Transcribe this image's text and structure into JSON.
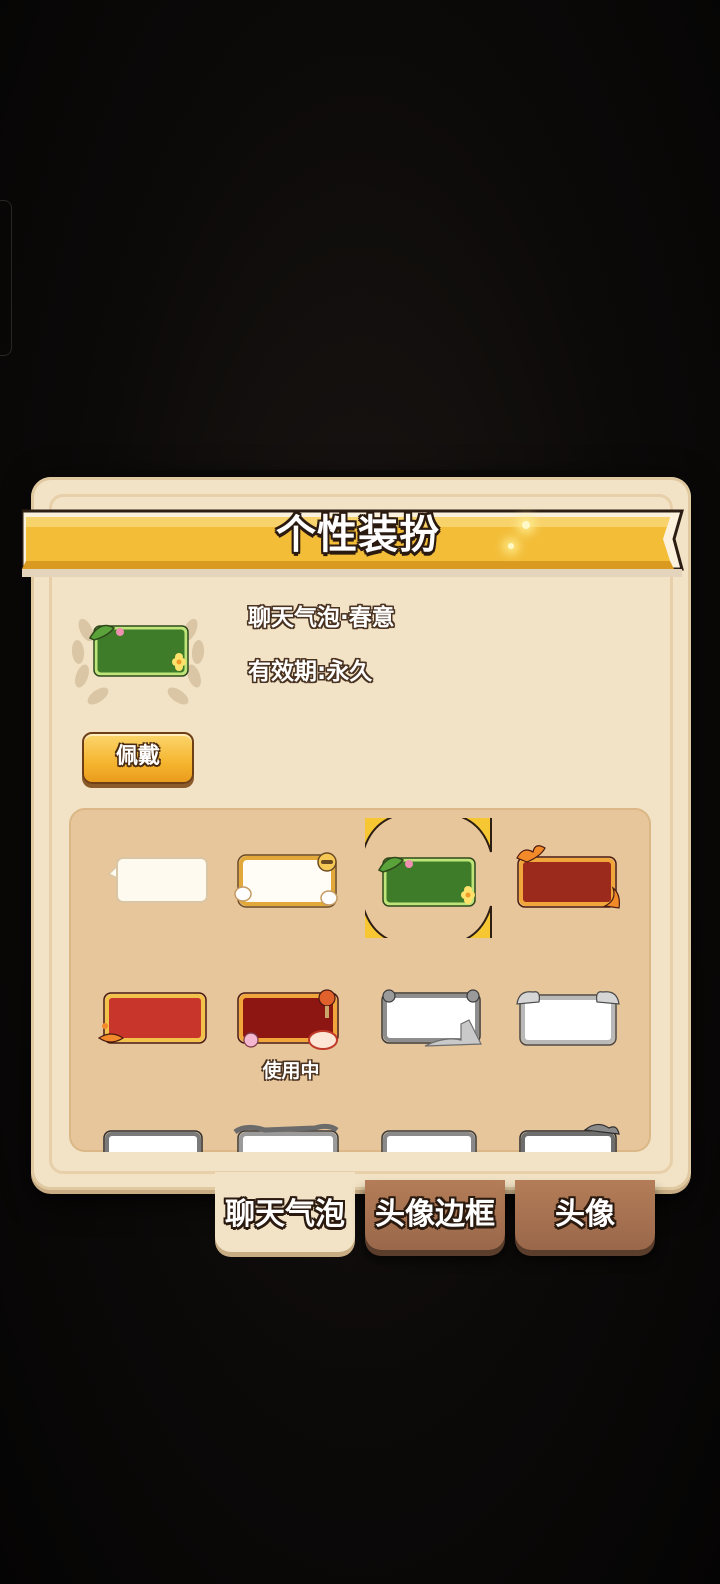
{
  "title": "个性装扮",
  "selected": {
    "name": "聊天气泡·春意",
    "validity": "有效期:永久",
    "wear_button": "佩戴"
  },
  "grid": {
    "in_use_label": "使用中",
    "items": [
      {
        "icon": "plain-white-bubble"
      },
      {
        "icon": "cream-cat-paw-bubble"
      },
      {
        "icon": "spring-green-bubble",
        "selected": true
      },
      {
        "icon": "flame-red-bubble"
      },
      {
        "icon": "red-koi-bubble"
      },
      {
        "icon": "lantern-red-bubble",
        "in_use": true
      },
      {
        "icon": "gray-stone-bubble"
      },
      {
        "icon": "white-cloud-bubble"
      },
      {
        "icon": "dark-gray-bubble"
      },
      {
        "icon": "silver-scroll-bubble"
      },
      {
        "icon": "gray-bubble"
      },
      {
        "icon": "dark-dragon-bubble"
      }
    ]
  },
  "tabs": [
    {
      "label": "聊天气泡",
      "active": true
    },
    {
      "label": "头像边框",
      "active": false
    },
    {
      "label": "头像",
      "active": false
    }
  ],
  "colors": {
    "panel": "#f2e3c6",
    "ribbon": "#f3bd38",
    "grid_bg": "#e8c69c",
    "tab_inactive": "#a77153",
    "button": "#f5b52f"
  }
}
